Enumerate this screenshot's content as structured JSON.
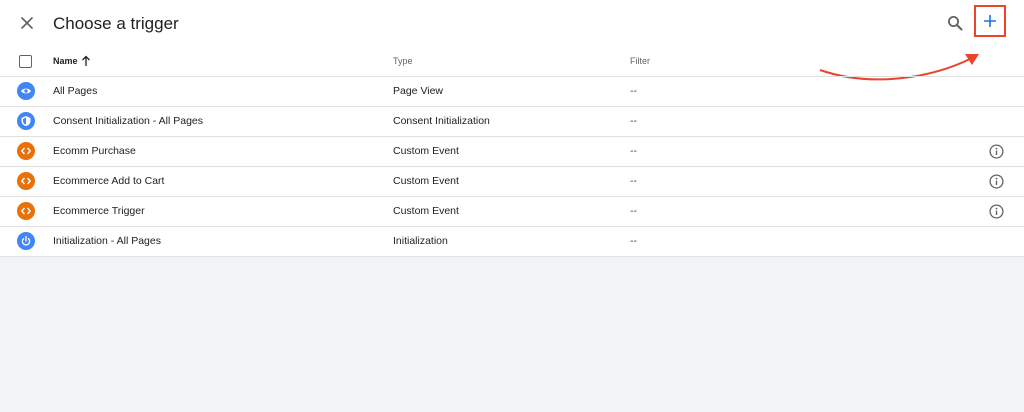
{
  "dialog": {
    "title": "Choose a trigger"
  },
  "colors": {
    "accent_blue": "#4285f4",
    "accent_orange": "#e8710a",
    "highlight_red": "#e8452c"
  },
  "table": {
    "columns": {
      "name": "Name",
      "type": "Type",
      "filter": "Filter"
    },
    "sort": "ascending",
    "rows": [
      {
        "name": "All Pages",
        "type": "Page View",
        "filter": "--",
        "icon": "eye-icon",
        "color": "#4285f4",
        "info": false
      },
      {
        "name": "Consent Initialization - All Pages",
        "type": "Consent Initialization",
        "filter": "--",
        "icon": "shield-icon",
        "color": "#4285f4",
        "info": false
      },
      {
        "name": "Ecomm Purchase",
        "type": "Custom Event",
        "filter": "--",
        "icon": "code-icon",
        "color": "#e8710a",
        "info": true
      },
      {
        "name": "Ecommerce Add to Cart",
        "type": "Custom Event",
        "filter": "--",
        "icon": "code-icon",
        "color": "#e8710a",
        "info": true
      },
      {
        "name": "Ecommerce Trigger",
        "type": "Custom Event",
        "filter": "--",
        "icon": "code-icon",
        "color": "#e8710a",
        "info": true
      },
      {
        "name": "Initialization - All Pages",
        "type": "Initialization",
        "filter": "--",
        "icon": "power-icon",
        "color": "#4285f4",
        "info": false
      }
    ]
  }
}
